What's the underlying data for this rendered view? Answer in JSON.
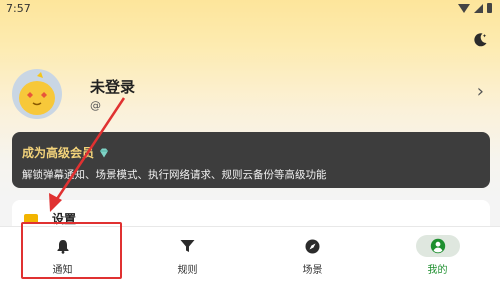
{
  "status_bar": {
    "time": "7:57"
  },
  "profile": {
    "username": "未登录",
    "handle": "@"
  },
  "premium": {
    "title": "成为高级会员",
    "description": "解锁弹幕通知、场景模式、执行网络请求、规则云备份等高级功能"
  },
  "settings": {
    "label": "设置"
  },
  "nav": {
    "items": [
      {
        "label": "通知",
        "icon": "bell-icon",
        "active": false
      },
      {
        "label": "规则",
        "icon": "filter-icon",
        "active": false
      },
      {
        "label": "场景",
        "icon": "compass-icon",
        "active": false
      },
      {
        "label": "我的",
        "icon": "account-icon",
        "active": true
      }
    ]
  },
  "colors": {
    "accent": "#1e8f2f",
    "annotation": "#e03131",
    "premium_bg": "#3d3d3d",
    "premium_title": "#f3d37a"
  }
}
